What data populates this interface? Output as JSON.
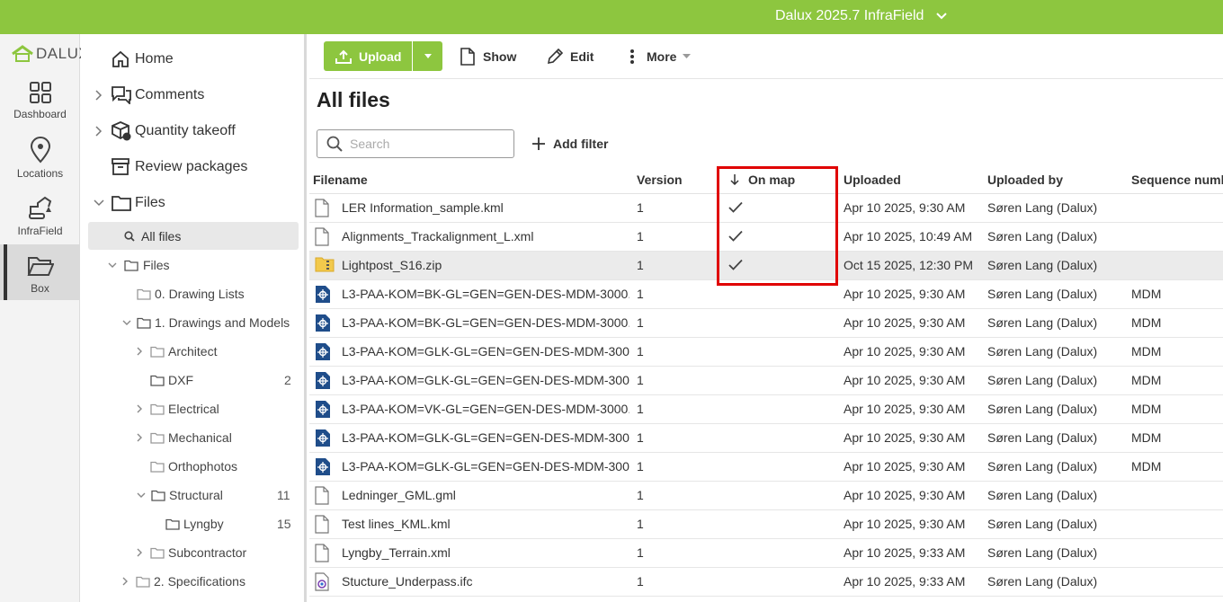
{
  "header": {
    "project_name": "Dalux 2025.7 InfraField",
    "brand_color": "#8dc63f"
  },
  "rail": {
    "logo_text": "DALUX",
    "items": [
      {
        "label": "Dashboard",
        "icon": "grid-icon"
      },
      {
        "label": "Locations",
        "icon": "location-pin-icon"
      },
      {
        "label": "InfraField",
        "icon": "excavator-icon"
      },
      {
        "label": "Box",
        "icon": "folder-open-icon",
        "active": true
      }
    ]
  },
  "tree": {
    "top_items": [
      {
        "label": "Home",
        "icon": "home-icon"
      },
      {
        "label": "Comments",
        "icon": "comments-icon"
      },
      {
        "label": "Quantity takeoff",
        "icon": "cube-icon"
      },
      {
        "label": "Review packages",
        "icon": "archive-icon"
      },
      {
        "label": "Files",
        "icon": "folder-icon"
      }
    ],
    "all_files_label": "All files",
    "nodes": [
      {
        "label": "Files",
        "count": ""
      },
      {
        "label": "0. Drawing Lists",
        "count": ""
      },
      {
        "label": "1. Drawings and Models",
        "count": ""
      },
      {
        "label": "Architect",
        "count": ""
      },
      {
        "label": "DXF",
        "count": "2"
      },
      {
        "label": "Electrical",
        "count": ""
      },
      {
        "label": "Mechanical",
        "count": ""
      },
      {
        "label": "Orthophotos",
        "count": ""
      },
      {
        "label": "Structural",
        "count": "11"
      },
      {
        "label": "Lyngby",
        "count": "15"
      },
      {
        "label": "Subcontractor",
        "count": ""
      },
      {
        "label": "2. Specifications",
        "count": ""
      }
    ]
  },
  "toolbar": {
    "upload_label": "Upload",
    "show_label": "Show",
    "edit_label": "Edit",
    "more_label": "More"
  },
  "main": {
    "title": "All files",
    "search_placeholder": "Search",
    "add_filter_label": "Add filter",
    "columns": {
      "filename": "Filename",
      "version": "Version",
      "on_map": "On map",
      "uploaded": "Uploaded",
      "uploaded_by": "Uploaded by",
      "sequence": "Sequence numb"
    },
    "rows": [
      {
        "filename": "LER Information_sample.kml",
        "version": "1",
        "on_map": true,
        "uploaded": "Apr 10 2025, 9:30 AM",
        "uploaded_by": "Søren Lang (Dalux)",
        "sequence": "",
        "type": "doc"
      },
      {
        "filename": "Alignments_Trackalignment_L.xml",
        "version": "1",
        "on_map": true,
        "uploaded": "Apr 10 2025, 10:49 AM",
        "uploaded_by": "Søren Lang (Dalux)",
        "sequence": "",
        "type": "doc"
      },
      {
        "filename": "Lightpost_S16.zip",
        "version": "1",
        "on_map": true,
        "uploaded": "Oct 15 2025, 12:30 PM",
        "uploaded_by": "Søren Lang (Dalux)",
        "sequence": "",
        "type": "zip",
        "selected": true
      },
      {
        "filename": "L3-PAA-KOM=BK-GL=GEN=GEN-DES-MDM-3000...",
        "version": "1",
        "on_map": false,
        "uploaded": "Apr 10 2025, 9:30 AM",
        "uploaded_by": "Søren Lang (Dalux)",
        "sequence": "MDM",
        "type": "model"
      },
      {
        "filename": "L3-PAA-KOM=BK-GL=GEN=GEN-DES-MDM-3000...",
        "version": "1",
        "on_map": false,
        "uploaded": "Apr 10 2025, 9:30 AM",
        "uploaded_by": "Søren Lang (Dalux)",
        "sequence": "MDM",
        "type": "model"
      },
      {
        "filename": "L3-PAA-KOM=GLK-GL=GEN=GEN-DES-MDM-300...",
        "version": "1",
        "on_map": false,
        "uploaded": "Apr 10 2025, 9:30 AM",
        "uploaded_by": "Søren Lang (Dalux)",
        "sequence": "MDM",
        "type": "model"
      },
      {
        "filename": "L3-PAA-KOM=GLK-GL=GEN=GEN-DES-MDM-300...",
        "version": "1",
        "on_map": false,
        "uploaded": "Apr 10 2025, 9:30 AM",
        "uploaded_by": "Søren Lang (Dalux)",
        "sequence": "MDM",
        "type": "model"
      },
      {
        "filename": "L3-PAA-KOM=VK-GL=GEN=GEN-DES-MDM-3000...",
        "version": "1",
        "on_map": false,
        "uploaded": "Apr 10 2025, 9:30 AM",
        "uploaded_by": "Søren Lang (Dalux)",
        "sequence": "MDM",
        "type": "model"
      },
      {
        "filename": "L3-PAA-KOM=GLK-GL=GEN=GEN-DES-MDM-300...",
        "version": "1",
        "on_map": false,
        "uploaded": "Apr 10 2025, 9:30 AM",
        "uploaded_by": "Søren Lang (Dalux)",
        "sequence": "MDM",
        "type": "model"
      },
      {
        "filename": "L3-PAA-KOM=GLK-GL=GEN=GEN-DES-MDM-300...",
        "version": "1",
        "on_map": false,
        "uploaded": "Apr 10 2025, 9:30 AM",
        "uploaded_by": "Søren Lang (Dalux)",
        "sequence": "MDM",
        "type": "model"
      },
      {
        "filename": "Ledninger_GML.gml",
        "version": "1",
        "on_map": false,
        "uploaded": "Apr 10 2025, 9:30 AM",
        "uploaded_by": "Søren Lang (Dalux)",
        "sequence": "",
        "type": "doc"
      },
      {
        "filename": "Test lines_KML.kml",
        "version": "1",
        "on_map": false,
        "uploaded": "Apr 10 2025, 9:30 AM",
        "uploaded_by": "Søren Lang (Dalux)",
        "sequence": "",
        "type": "doc"
      },
      {
        "filename": "Lyngby_Terrain.xml",
        "version": "1",
        "on_map": false,
        "uploaded": "Apr 10 2025, 9:33 AM",
        "uploaded_by": "Søren Lang (Dalux)",
        "sequence": "",
        "type": "doc"
      },
      {
        "filename": "Stucture_Underpass.ifc",
        "version": "1",
        "on_map": false,
        "uploaded": "Apr 10 2025, 9:33 AM",
        "uploaded_by": "Søren Lang (Dalux)",
        "sequence": "",
        "type": "ifc"
      }
    ]
  }
}
